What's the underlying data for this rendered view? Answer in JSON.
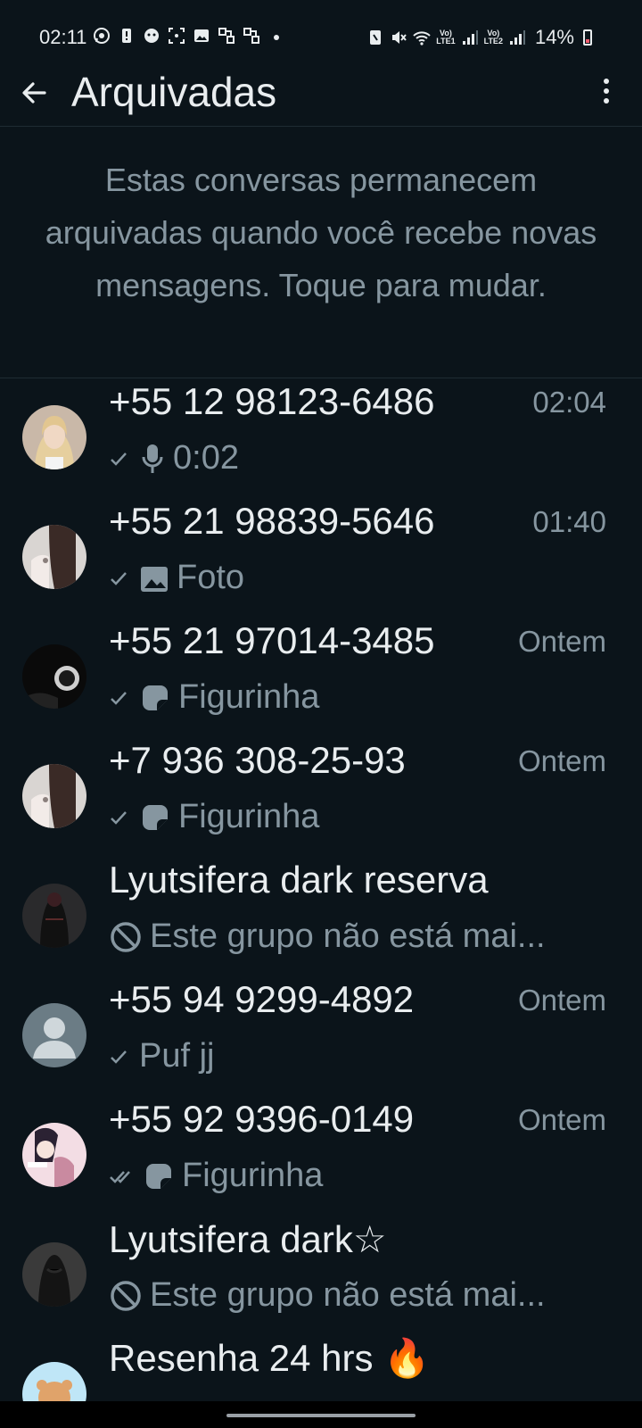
{
  "status_bar": {
    "time": "02:11",
    "battery": "14%",
    "lte1": "LTE1",
    "lte2": "LTE2",
    "icons_left": [
      "whatsapp-icon",
      "alert-icon",
      "bug-icon",
      "screenshot-icon",
      "gallery-icon",
      "link-icon",
      "link-icon",
      "dot-icon"
    ],
    "icons_right": [
      "nfc-icon",
      "mute-icon",
      "wifi-icon",
      "signal-icon",
      "signal-icon",
      "battery-icon"
    ]
  },
  "header": {
    "title": "Arquivadas"
  },
  "info_text": "Estas conversas permanecem arquivadas quando você recebe novas mensagens. Toque para mudar.",
  "chats": [
    {
      "name": "+55 12 98123-6486",
      "time": "02:04",
      "status": "single-check",
      "media_icon": "mic-icon",
      "preview": "0:02"
    },
    {
      "name": "+55 21 98839-5646",
      "time": "01:40",
      "status": "single-check",
      "media_icon": "image-icon",
      "preview": "Foto"
    },
    {
      "name": "+55 21 97014-3485",
      "time": "Ontem",
      "status": "single-check",
      "media_icon": "sticker-icon",
      "preview": "Figurinha"
    },
    {
      "name": "+7 936 308-25-93",
      "time": "Ontem",
      "status": "single-check",
      "media_icon": "sticker-icon",
      "preview": "Figurinha"
    },
    {
      "name": "Lyutsifera dark reserva",
      "time": "",
      "status": "",
      "media_icon": "blocked-icon",
      "preview": "Este grupo não está mai..."
    },
    {
      "name": "+55 94 9299-4892",
      "time": "Ontem",
      "status": "single-check",
      "media_icon": "",
      "preview": "Puf jj"
    },
    {
      "name": "+55 92 9396-0149",
      "time": "Ontem",
      "status": "double-check",
      "media_icon": "sticker-icon",
      "preview": "Figurinha"
    },
    {
      "name": "Lyutsifera dark☆",
      "time": "",
      "status": "",
      "media_icon": "blocked-icon",
      "preview": "Este grupo não está mai..."
    },
    {
      "name": "Resenha 24 hrs 🔥",
      "time": "",
      "status": "",
      "media_icon": "",
      "preview": ""
    }
  ],
  "colors": {
    "background": "#0b141a",
    "primary_text": "#e9edef",
    "secondary_text": "#8696a0"
  }
}
